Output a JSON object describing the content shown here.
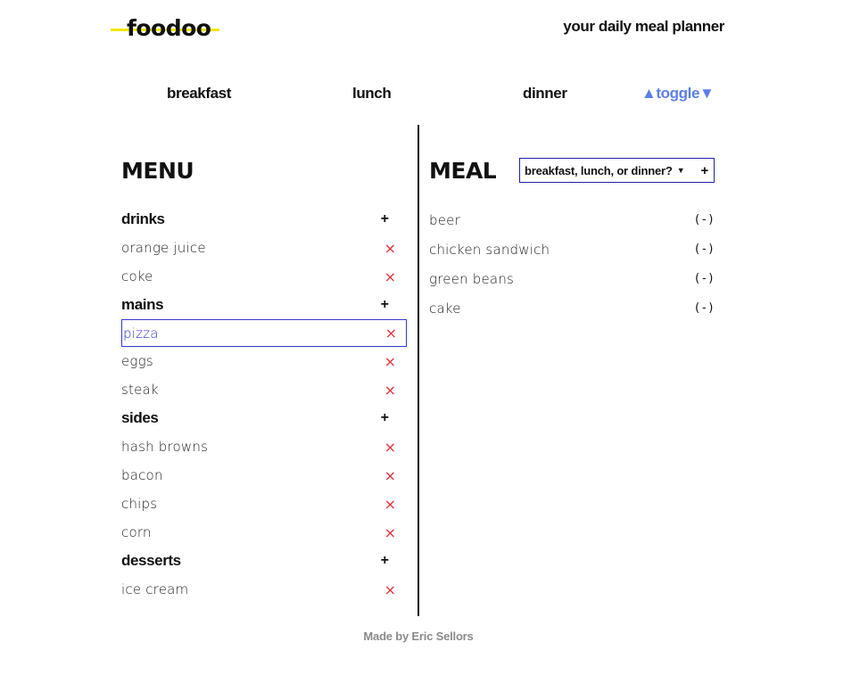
{
  "header": {
    "logo": "foodoo",
    "tagline": "your daily meal planner"
  },
  "nav": {
    "breakfast": "breakfast",
    "lunch": "lunch",
    "dinner": "dinner",
    "toggle": "▲toggle▼"
  },
  "menu": {
    "title": "MENU",
    "add_symbol": "+",
    "remove_symbol": "×",
    "categories": [
      {
        "label": "drinks",
        "items": [
          "orange juice",
          "coke"
        ]
      },
      {
        "label": "mains",
        "items": [
          "pizza",
          "eggs",
          "steak"
        ]
      },
      {
        "label": "sides",
        "items": [
          "hash browns",
          "bacon",
          "chips",
          "corn"
        ]
      },
      {
        "label": "desserts",
        "items": [
          "ice cream"
        ]
      }
    ],
    "selected_item": "pizza"
  },
  "meal": {
    "title": "MEAL",
    "select_value": "breakfast, lunch, or dinner?",
    "select_caret": "▼",
    "add_symbol": "+",
    "remove_symbol": "(-)",
    "items": [
      "beer",
      "chicken sandwich",
      "green beans",
      "cake"
    ]
  },
  "footer": {
    "text": "Made by Eric Sellors"
  },
  "colors": {
    "accent_yellow": "#f2e600",
    "toggle_blue": "#5b7fe8",
    "remove_red": "#e0303a",
    "selected_blue": "#3b3bd6",
    "footer_gray": "#8a8a8a"
  }
}
